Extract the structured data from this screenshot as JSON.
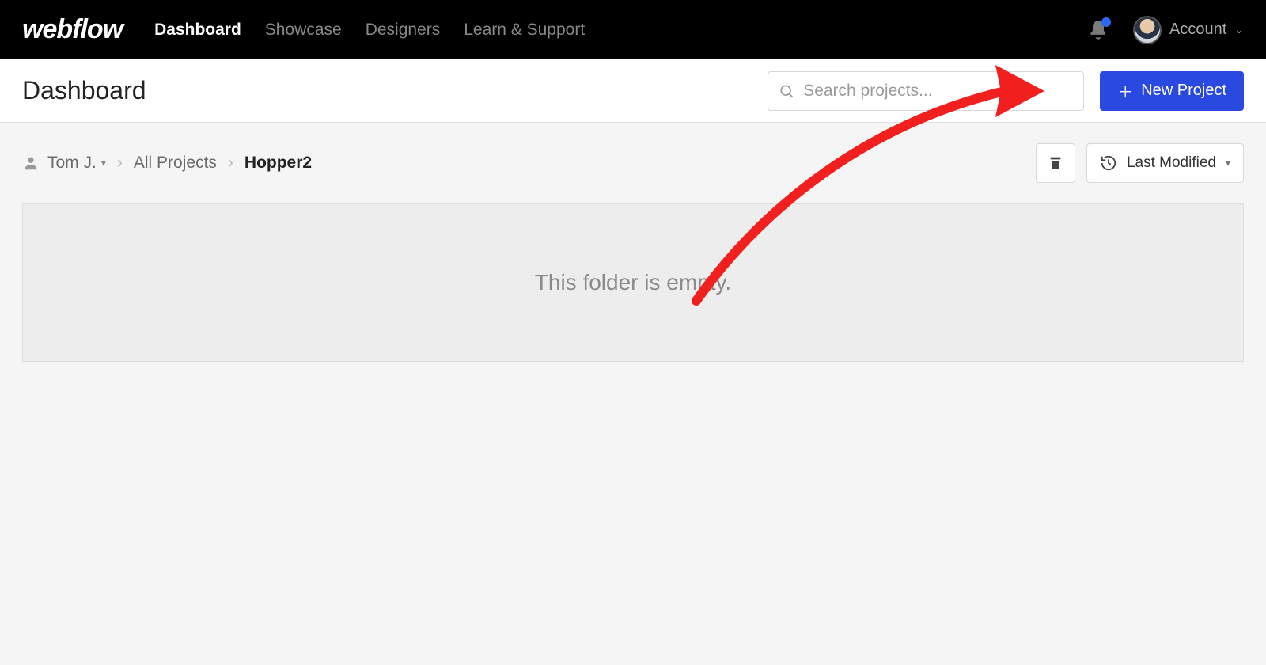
{
  "brand": "webflow",
  "nav": {
    "items": [
      "Dashboard",
      "Showcase",
      "Designers",
      "Learn & Support"
    ],
    "active_index": 0
  },
  "account": {
    "label": "Account"
  },
  "page": {
    "title": "Dashboard"
  },
  "search": {
    "placeholder": "Search projects..."
  },
  "actions": {
    "new_project": "New Project"
  },
  "breadcrumb": {
    "user": "Tom J.",
    "items": [
      "All Projects",
      "Hopper2"
    ]
  },
  "sort": {
    "label": "Last Modified"
  },
  "empty_state": {
    "message": "This folder is empty."
  }
}
